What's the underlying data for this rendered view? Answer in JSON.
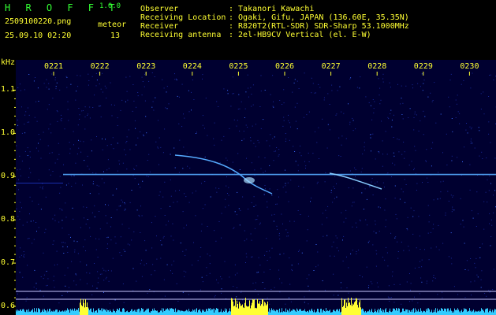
{
  "header": {
    "app_name": "H R O F F T",
    "version": "1.0.0",
    "filename": "2509100220.png",
    "datetime": "25.09.10 02:20",
    "meteor_label": "meteor",
    "meteor_count": "13",
    "fields": [
      {
        "label": "Observer",
        "value": ": Takanori Kawachi"
      },
      {
        "label": "Receiving Location",
        "value": ": Ogaki, Gifu, JAPAN (136.60E, 35.35N)"
      },
      {
        "label": "Receiver",
        "value": ": R820T2(RTL-SDR) SDR-Sharp 53.1000MHz"
      },
      {
        "label": "Receiving antenna",
        "value": ": 2el-HB9CV Vertical (el. E-W)"
      }
    ]
  },
  "chart_data": {
    "type": "heatmap",
    "ylabel": "kHz",
    "x_ticks": [
      "0221",
      "0222",
      "0223",
      "0224",
      "0225",
      "0226",
      "0227",
      "0228",
      "0229",
      "0230"
    ],
    "y_ticks": [
      "1.1",
      "1.0",
      "0.9",
      "0.8",
      "0.7",
      "0.6"
    ],
    "ylim": [
      0.58,
      1.17
    ],
    "colors": {
      "background": "#000030",
      "carrier": "#55aaff",
      "bars": "#33ccff",
      "highlight": "#ffff33"
    }
  }
}
